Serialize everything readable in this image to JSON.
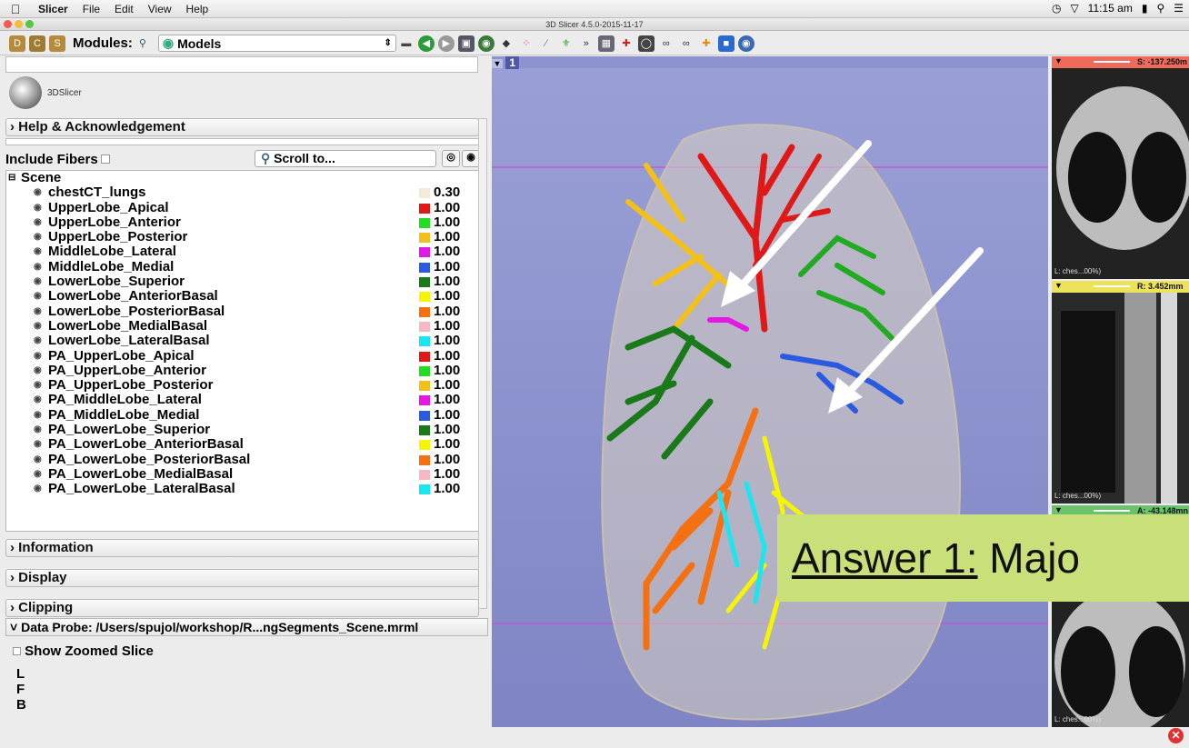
{
  "menubar": {
    "app": "Slicer",
    "items": [
      "File",
      "Edit",
      "View",
      "Help"
    ],
    "clock": "11:15 am"
  },
  "window": {
    "title": "3D Slicer 4.5.0-2015-11-17"
  },
  "toolbar": {
    "modules_label": "Modules:",
    "module_selected": "Models"
  },
  "logo": {
    "text": "3DSlicer"
  },
  "sections": {
    "help": "Help & Acknowledgement",
    "information": "Information",
    "display": "Display",
    "clipping": "Clipping",
    "data_probe": "Data Probe: /Users/spujol/workshop/R...ngSegments_Scene.mrml"
  },
  "filter": {
    "include_fibers": "Include Fibers",
    "scroll_to": "Scroll to..."
  },
  "tree": {
    "root": "Scene",
    "rows": [
      {
        "name": "chestCT_lungs",
        "color": "#f5ead8",
        "opacity": "0.30"
      },
      {
        "name": "UpperLobe_Apical",
        "color": "#e01818",
        "opacity": "1.00"
      },
      {
        "name": "UpperLobe_Anterior",
        "color": "#22dd22",
        "opacity": "1.00"
      },
      {
        "name": "UpperLobe_Posterior",
        "color": "#f2c018",
        "opacity": "1.00"
      },
      {
        "name": "MiddleLobe_Lateral",
        "color": "#e418e4",
        "opacity": "1.00"
      },
      {
        "name": "MiddleLobe_Medial",
        "color": "#2a5ae0",
        "opacity": "1.00"
      },
      {
        "name": "LowerLobe_Superior",
        "color": "#1a7a1a",
        "opacity": "1.00"
      },
      {
        "name": "LowerLobe_AnteriorBasal",
        "color": "#f5f500",
        "opacity": "1.00"
      },
      {
        "name": "LowerLobe_PosteriorBasal",
        "color": "#f57010",
        "opacity": "1.00"
      },
      {
        "name": "LowerLobe_MedialBasal",
        "color": "#f6b8c4",
        "opacity": "1.00"
      },
      {
        "name": "LowerLobe_LateralBasal",
        "color": "#18e6f0",
        "opacity": "1.00"
      },
      {
        "name": "PA_UpperLobe_Apical",
        "color": "#e01818",
        "opacity": "1.00"
      },
      {
        "name": "PA_UpperLobe_Anterior",
        "color": "#22dd22",
        "opacity": "1.00"
      },
      {
        "name": "PA_UpperLobe_Posterior",
        "color": "#f2c018",
        "opacity": "1.00"
      },
      {
        "name": "PA_MiddleLobe_Lateral",
        "color": "#e418e4",
        "opacity": "1.00"
      },
      {
        "name": "PA_MiddleLobe_Medial",
        "color": "#2a5ae0",
        "opacity": "1.00"
      },
      {
        "name": "PA_LowerLobe_Superior",
        "color": "#1a7a1a",
        "opacity": "1.00"
      },
      {
        "name": "PA_LowerLobe_AnteriorBasal",
        "color": "#f5f500",
        "opacity": "1.00"
      },
      {
        "name": "PA_LowerLobe_PosteriorBasal",
        "color": "#f57010",
        "opacity": "1.00"
      },
      {
        "name": "PA_LowerLobe_MedialBasal",
        "color": "#f6b8c4",
        "opacity": "1.00"
      },
      {
        "name": "PA_LowerLobe_LateralBasal",
        "color": "#18e6f0",
        "opacity": "1.00"
      }
    ]
  },
  "probe": {
    "show_zoomed": "Show Zoomed Slice",
    "l": "L",
    "f": "F",
    "b": "B"
  },
  "view3d": {
    "label": "1"
  },
  "slices": {
    "red": {
      "offset": "S: -137.250m",
      "layer": "L: ches...00%)",
      "color": "#f06a5a"
    },
    "yellow": {
      "offset": "R: 3.452mm",
      "layer": "L: ches...00%)",
      "color": "#ede35a"
    },
    "green": {
      "offset": "A: -43.148mn",
      "layer": "L: ches...00%)",
      "color": "#6cc26c"
    }
  },
  "overlay": {
    "answer_prefix": "Answer 1:",
    "answer_rest": " Majo"
  }
}
